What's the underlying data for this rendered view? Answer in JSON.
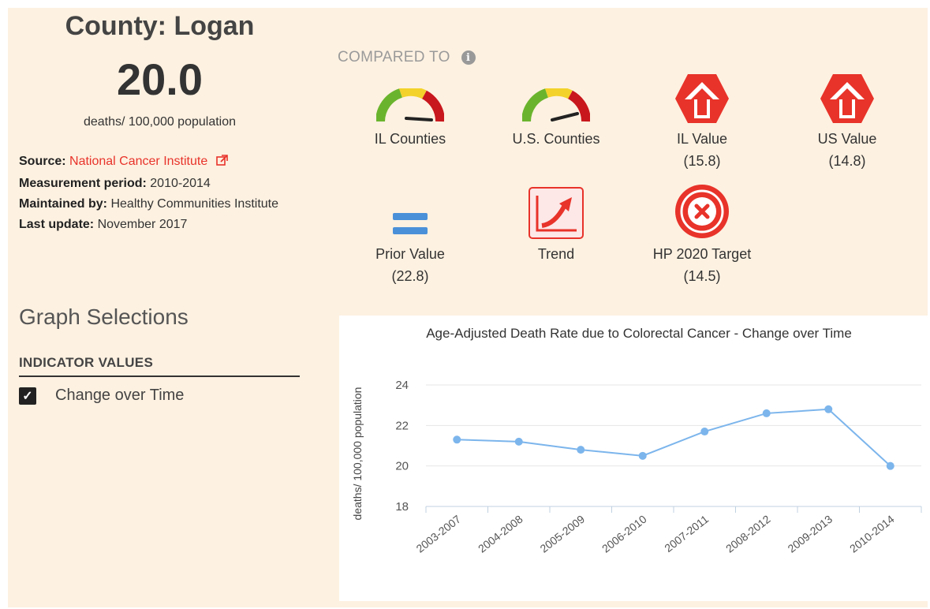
{
  "county": {
    "title": "County: Logan",
    "value": "20.0",
    "units": "deaths/ 100,000 population"
  },
  "meta": {
    "source_label": "Source:",
    "source_value": "National Cancer Institute",
    "period_label": "Measurement period:",
    "period_value": "2010-2014",
    "maintained_label": "Maintained by:",
    "maintained_value": "Healthy Communities Institute",
    "update_label": "Last update:",
    "update_value": "November 2017"
  },
  "compared_to": {
    "label": "COMPARED TO",
    "items": [
      {
        "label": "IL Counties",
        "value": "",
        "icon": "gauge-icon"
      },
      {
        "label": "U.S. Counties",
        "value": "",
        "icon": "gauge-icon"
      },
      {
        "label": "IL Value",
        "value": "(15.8)",
        "icon": "red-up-arrow-diamond-icon"
      },
      {
        "label": "US Value",
        "value": "(14.8)",
        "icon": "red-up-arrow-diamond-icon"
      },
      {
        "label": "Prior Value",
        "value": "(22.8)",
        "icon": "equals-icon"
      },
      {
        "label": "Trend",
        "value": "",
        "icon": "trend-up-icon"
      },
      {
        "label": "HP 2020 Target",
        "value": "(14.5)",
        "icon": "red-x-circle-icon"
      }
    ]
  },
  "graph_selections": {
    "title": "Graph Selections",
    "indicator_header": "INDICATOR VALUES",
    "checkbox_label": "Change over Time",
    "checked": true
  },
  "colors": {
    "accent_red": "#e8332a",
    "line_blue": "#7cb5ec",
    "equals_blue": "#4a90d9"
  },
  "chart_data": {
    "type": "line",
    "title": "Age-Adjusted Death Rate due to Colorectal Cancer - Change over Time",
    "ylabel": "deaths/ 100,000 population",
    "xlabel": "",
    "categories": [
      "2003-2007",
      "2004-2008",
      "2005-2009",
      "2006-2010",
      "2007-2011",
      "2008-2012",
      "2009-2013",
      "2010-2014"
    ],
    "series": [
      {
        "values": [
          21.3,
          21.2,
          20.8,
          20.5,
          21.7,
          22.6,
          22.8,
          20.0
        ]
      }
    ],
    "ylim": [
      18,
      24
    ],
    "yticks": [
      18,
      20,
      22,
      24
    ],
    "grid": true,
    "legend": "none"
  }
}
